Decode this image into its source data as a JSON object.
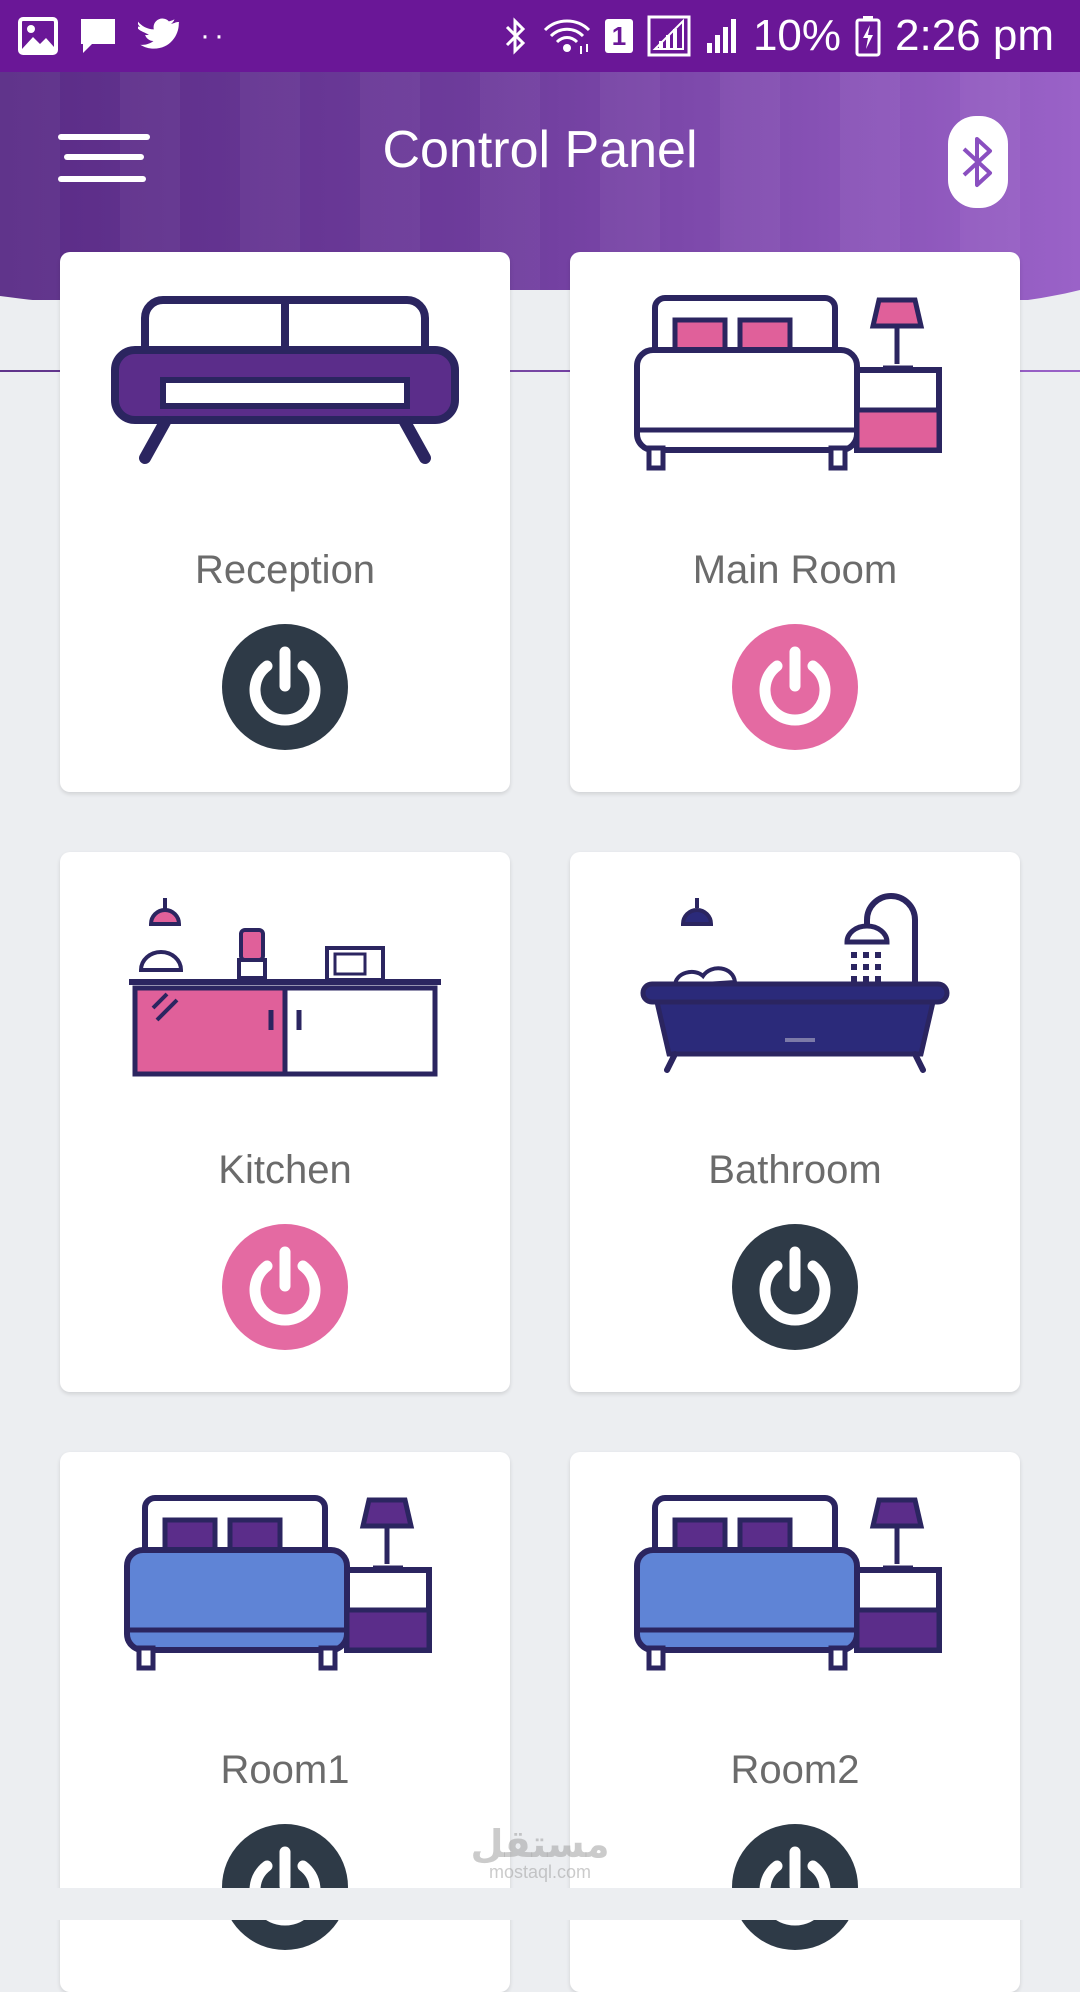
{
  "status_bar": {
    "battery_percent": "10%",
    "time": "2:26 pm",
    "sim_slot": "1",
    "left_icons": [
      "gallery-icon",
      "message-icon",
      "twitter-icon",
      "more-dots-icon"
    ],
    "right_icons": [
      "bluetooth-icon",
      "wifi-icon",
      "signal-icon",
      "signal-icon",
      "battery-charging-icon"
    ]
  },
  "header": {
    "title": "Control Panel",
    "menu_icon": "hamburger-menu-icon",
    "bluetooth_icon": "bluetooth-icon"
  },
  "colors": {
    "accent_purple": "#6a1797",
    "power_on": "#e46aa2",
    "power_off": "#2e3a47"
  },
  "rooms": [
    {
      "label": "Reception",
      "icon": "sofa-icon",
      "power": "off"
    },
    {
      "label": "Main Room",
      "icon": "bed-nightstand-icon",
      "power": "on"
    },
    {
      "label": "Kitchen",
      "icon": "kitchen-counter-icon",
      "power": "on"
    },
    {
      "label": "Bathroom",
      "icon": "bathtub-shower-icon",
      "power": "off"
    },
    {
      "label": "Room1",
      "icon": "bed-nightstand-icon",
      "power": "off"
    },
    {
      "label": "Room2",
      "icon": "bed-nightstand-icon",
      "power": "off"
    }
  ],
  "watermark": {
    "text": "مستقل",
    "sub": "mostaql.com"
  }
}
